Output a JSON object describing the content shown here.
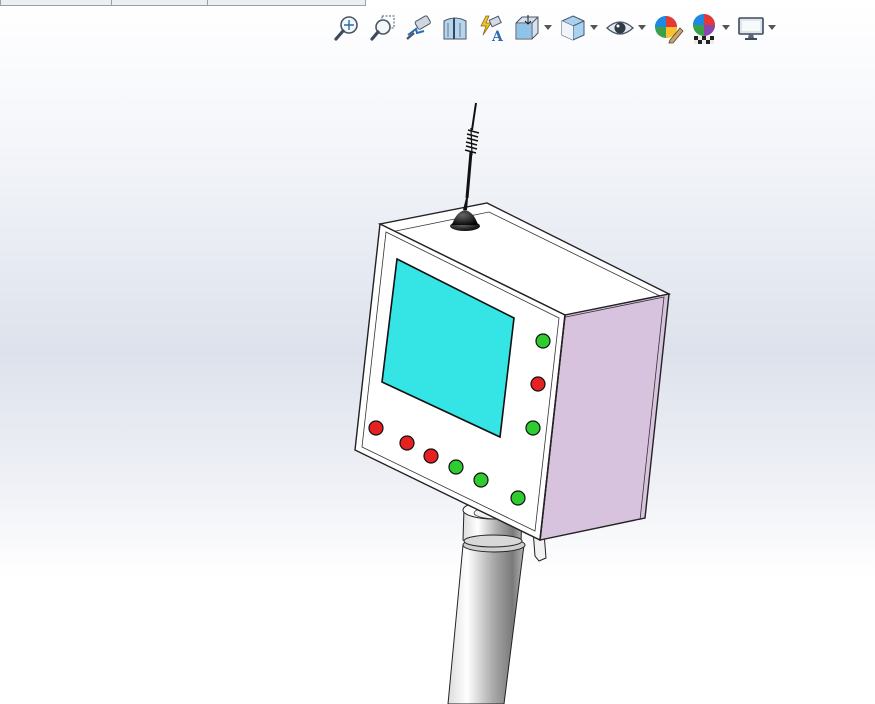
{
  "tab_strip": {
    "tabs": [
      {
        "label": ""
      },
      {
        "label": ""
      },
      {
        "label": ""
      }
    ]
  },
  "heads_up_toolbar": {
    "buttons": [
      {
        "name": "zoom-to-fit",
        "icon": "zoom-to-fit-icon",
        "has_dropdown": false
      },
      {
        "name": "zoom-to-area",
        "icon": "zoom-to-area-icon",
        "has_dropdown": false
      },
      {
        "name": "previous-view",
        "icon": "previous-view-icon",
        "has_dropdown": false
      },
      {
        "name": "section-view",
        "icon": "section-view-icon",
        "has_dropdown": false
      },
      {
        "name": "dynamic-annotation-views",
        "icon": "dynamic-annotation-icon",
        "has_dropdown": false
      },
      {
        "name": "view-orientation",
        "icon": "view-orientation-icon",
        "has_dropdown": true
      },
      {
        "name": "display-style",
        "icon": "display-style-icon",
        "has_dropdown": true
      },
      {
        "name": "hide-show-items",
        "icon": "eye-icon",
        "has_dropdown": true
      },
      {
        "name": "edit-appearance",
        "icon": "edit-appearance-icon",
        "has_dropdown": false
      },
      {
        "name": "apply-scene",
        "icon": "apply-scene-icon",
        "has_dropdown": true
      },
      {
        "name": "view-settings",
        "icon": "monitor-icon",
        "has_dropdown": true
      }
    ]
  },
  "model": {
    "screen_color": "#35e4e4",
    "side_panel_color": "#d8c3de",
    "button_colors": {
      "red": "#e62121",
      "green": "#2fcc2f"
    }
  }
}
